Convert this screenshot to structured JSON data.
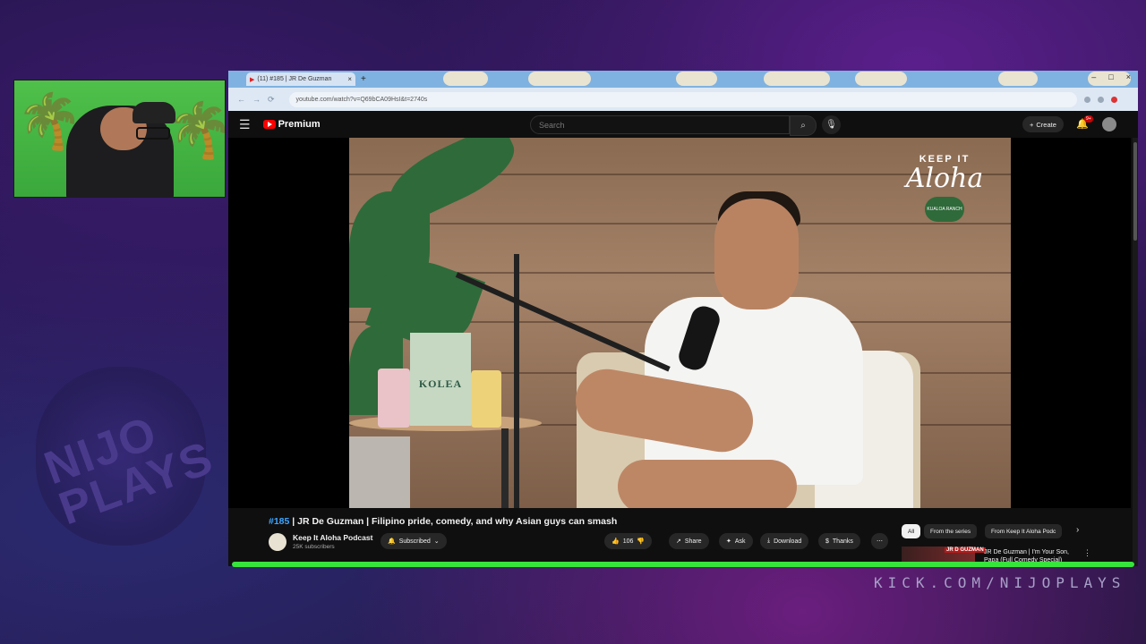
{
  "stream": {
    "overlay_url": "KICK.COM/NIJOPLAYS",
    "logo_text_line1": "NIJO",
    "logo_text_line2": "PLAYS"
  },
  "browser": {
    "tab_title": "(11) #185 | JR De Guzman",
    "tab_close": "×",
    "new_tab": "+",
    "window_controls": [
      "–",
      "□",
      "×"
    ],
    "nav": [
      "←",
      "→",
      "⟳"
    ],
    "url": "youtube.com/watch?v=Q69bCA09HsI&t=2740s"
  },
  "youtube": {
    "brand": "Premium",
    "menu_icon": "☰",
    "search_placeholder": "Search",
    "search_icon": "⌕",
    "mic_icon": "🎙",
    "create_label": "Create",
    "create_plus": "+",
    "bell_icon": "🔔",
    "notif_count": "9+",
    "video": {
      "watermark_top": "KEEP IT",
      "watermark_script": "Aloha",
      "watermark_badge": "KUALOA RANCH",
      "product_label": "KOLEA"
    },
    "title_hash": "#185",
    "title_rest": " | JR De Guzman | Filipino pride, comedy, and why Asian guys can smash",
    "channel": {
      "name": "Keep It Aloha Podcast",
      "subscribers": "25K subscribers",
      "avatar_text": "Aloha"
    },
    "actions": {
      "subscribed": "Subscribed",
      "bell_icon": "🔔",
      "chevron": "⌄",
      "like_icon": "👍",
      "like_count": "106",
      "dislike_icon": "👎",
      "share_icon": "↗",
      "share": "Share",
      "ask_icon": "✦",
      "ask": "Ask",
      "download_icon": "⤓",
      "download": "Download",
      "thanks_icon": "$",
      "thanks": "Thanks",
      "more": "⋯"
    },
    "chips": [
      "All",
      "From the series",
      "From Keep It Aloha Podc"
    ],
    "chip_next": "›",
    "recommended": {
      "thumb_label": "JR D GUZMAN",
      "title": "JR De Guzman | I'm Your Son, Papa (Full Comedy Special)",
      "more_icon": "⋮"
    }
  }
}
